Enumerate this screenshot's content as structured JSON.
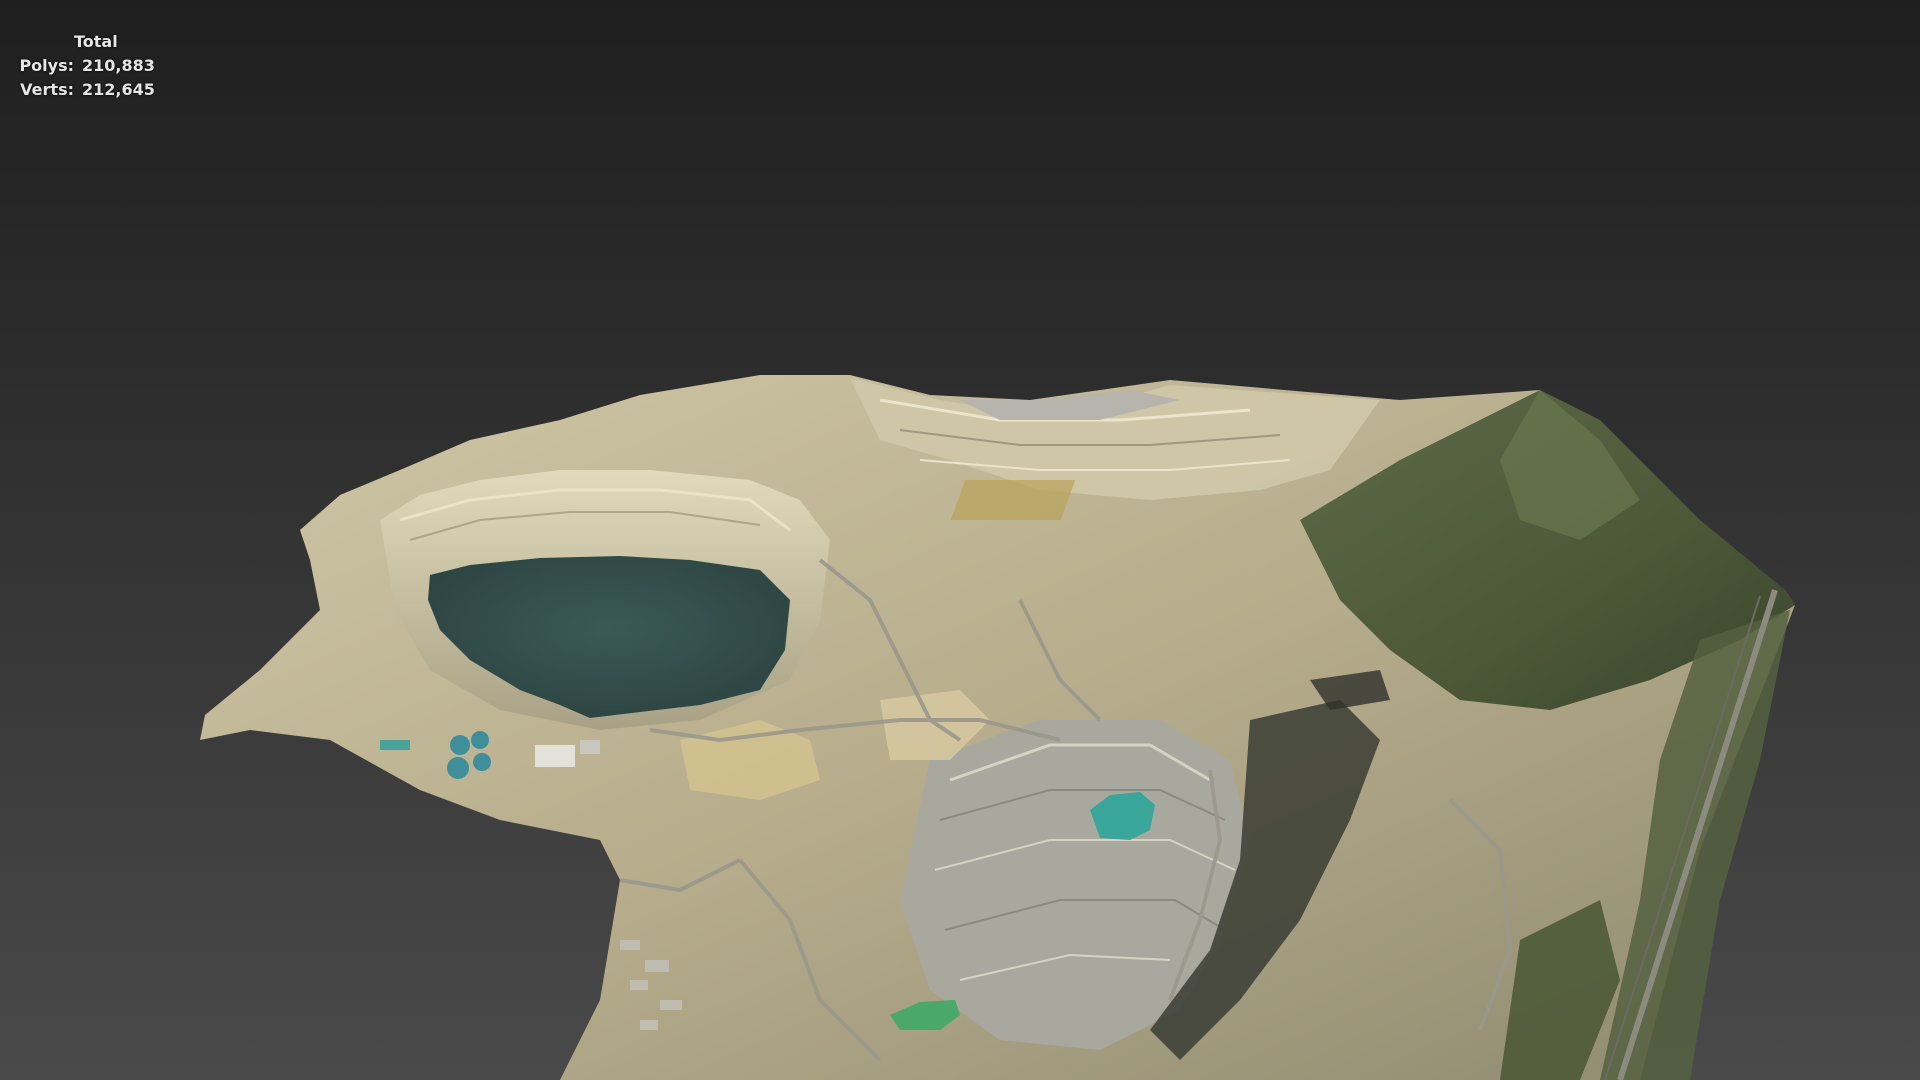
{
  "stats": {
    "title": "Total",
    "polys_label": "Polys:",
    "polys_value": "210,883",
    "verts_label": "Verts:",
    "verts_value": "212,645"
  },
  "viewport": {
    "background_top": "#1f1f1f",
    "background_bottom": "#4a4a4a",
    "model": "open-pit mine terrain mesh"
  },
  "colors": {
    "pit_lake": "#34504e",
    "teal_pond": "#3aa59a",
    "green_pond": "#4aa86a",
    "tailings": "#c9c0a0",
    "vegetation": "#4a5a3a",
    "rock_gray": "#a6a69a"
  }
}
